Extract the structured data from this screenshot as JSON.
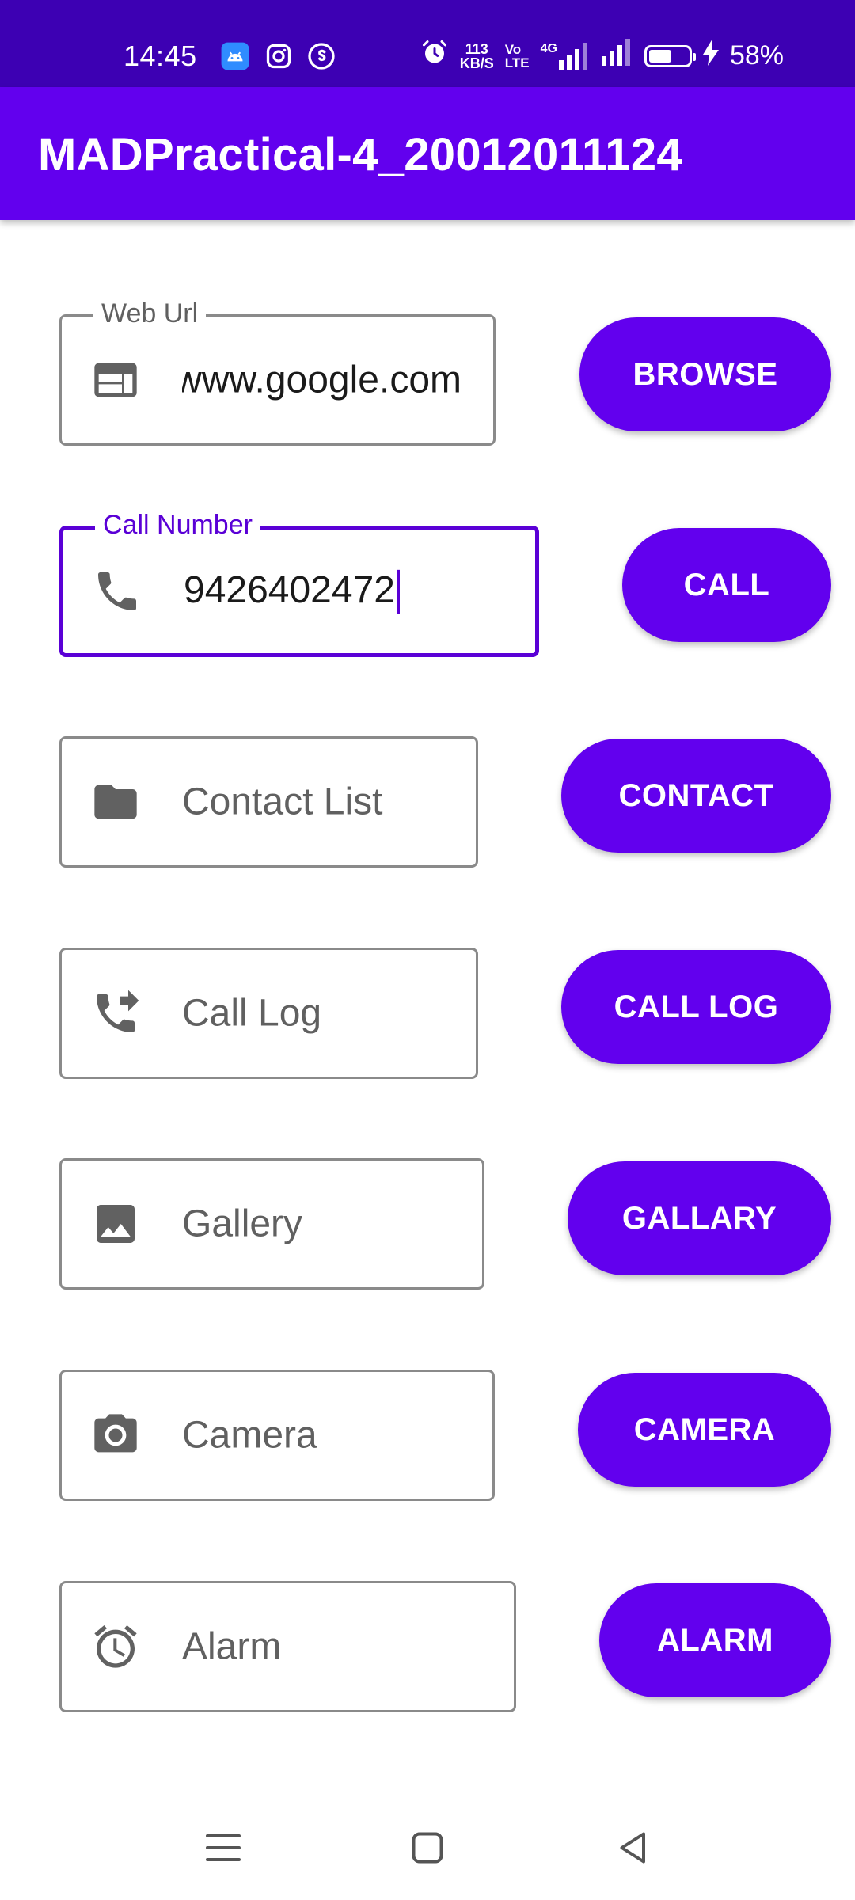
{
  "status_bar": {
    "time": "14:45",
    "net_speed_value": "113",
    "net_speed_unit": "KB/S",
    "volte_top": "Vo",
    "volte_bottom": "LTE",
    "network_type": "4G",
    "battery_percent": "58%",
    "battery_level": 0.58
  },
  "app_bar": {
    "title": "MADPractical-4_20012011124"
  },
  "rows": [
    {
      "label": "Web Url",
      "value": "www.google.com",
      "icon": "web-icon",
      "button": "BROWSE"
    },
    {
      "label": "Call Number",
      "value": "9426402472",
      "icon": "phone-icon",
      "button": "CALL"
    },
    {
      "placeholder": "Contact List",
      "icon": "folder-icon",
      "button": "CONTACT"
    },
    {
      "placeholder": "Call Log",
      "icon": "phone-forwarded-icon",
      "button": "CALL LOG"
    },
    {
      "placeholder": "Gallery",
      "icon": "image-icon",
      "button": "GALLARY"
    },
    {
      "placeholder": "Camera",
      "icon": "camera-icon",
      "button": "CAMERA"
    },
    {
      "placeholder": "Alarm",
      "icon": "alarm-icon",
      "button": "ALARM"
    }
  ],
  "colors": {
    "status_bar": "#3d00b3",
    "primary": "#6200ee",
    "focused_outline": "#5a00d6",
    "outline": "#8a8a8a",
    "icon": "#616161"
  }
}
